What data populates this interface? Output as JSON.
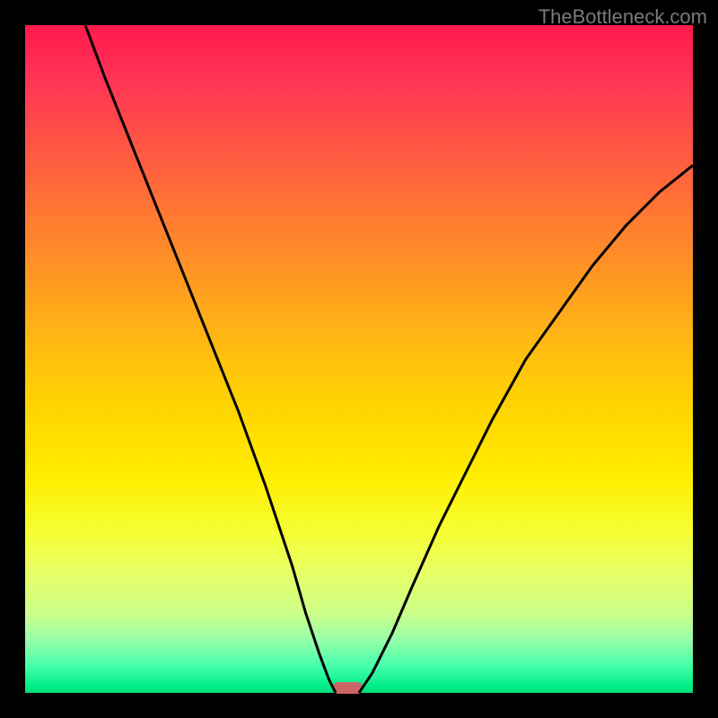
{
  "watermark": "TheBottleneck.com",
  "chart_data": {
    "type": "line",
    "title": "",
    "xlabel": "",
    "ylabel": "",
    "x_range": [
      0,
      100
    ],
    "y_range": [
      0,
      100
    ],
    "series": [
      {
        "name": "left-curve",
        "x": [
          9,
          12,
          16,
          20,
          24,
          28,
          32,
          36,
          40,
          42,
          44,
          45.5,
          46.5
        ],
        "y": [
          100,
          92,
          82,
          72,
          62,
          52,
          42,
          31,
          19,
          12,
          6,
          2,
          0
        ]
      },
      {
        "name": "right-curve",
        "x": [
          50,
          52,
          55,
          58,
          62,
          66,
          70,
          75,
          80,
          85,
          90,
          95,
          100
        ],
        "y": [
          0,
          3,
          9,
          16,
          25,
          33,
          41,
          50,
          57,
          64,
          70,
          75,
          79
        ]
      }
    ],
    "marker": {
      "x_center": 48.3,
      "y": 0,
      "width": 4.5,
      "color": "#cc6666"
    },
    "colors": {
      "gradient_top": "#ff1a4d",
      "gradient_bottom": "#00dd77",
      "curve": "#000000",
      "background": "#000000"
    }
  }
}
